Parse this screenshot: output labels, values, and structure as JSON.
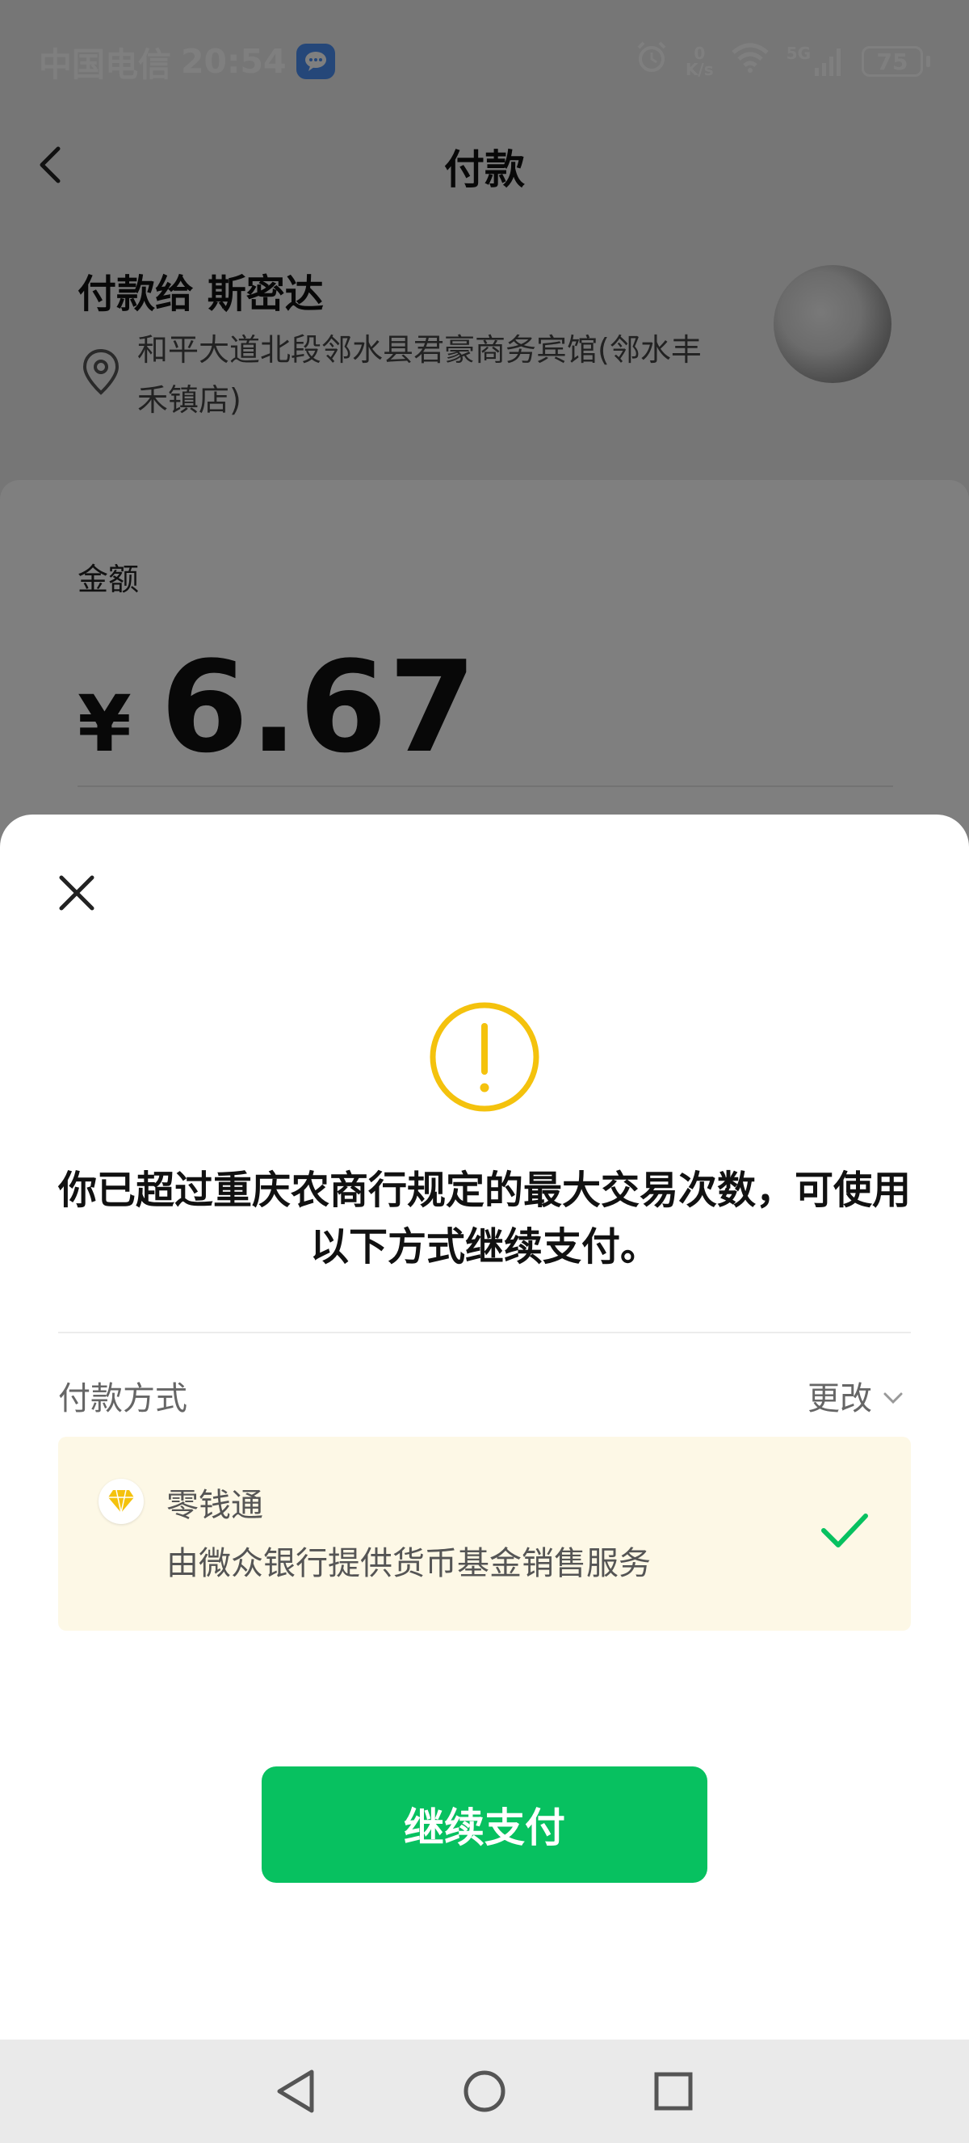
{
  "status_bar": {
    "carrier": "中国电信",
    "time": "20:54",
    "net_speed_value": "0",
    "net_speed_unit": "K/s",
    "network": "5G",
    "battery": "75"
  },
  "header": {
    "title": "付款"
  },
  "payee": {
    "name": "付款给 斯密达",
    "address": "和平大道北段邻水县君豪商务宾馆(邻水丰禾镇店)"
  },
  "amount": {
    "label": "金额",
    "currency": "¥",
    "value": "6.67"
  },
  "sheet": {
    "message": "你已超过重庆农商行规定的最大交易次数，可使用以下方式继续支付。",
    "payment_method_label": "付款方式",
    "change_label": "更改",
    "method": {
      "name": "零钱通",
      "description": "由微众银行提供货币基金销售服务"
    },
    "continue_button": "继续支付"
  },
  "colors": {
    "primary_green": "#07c160",
    "warning_yellow": "#f4c20d",
    "method_bg": "#fdf8e6"
  }
}
